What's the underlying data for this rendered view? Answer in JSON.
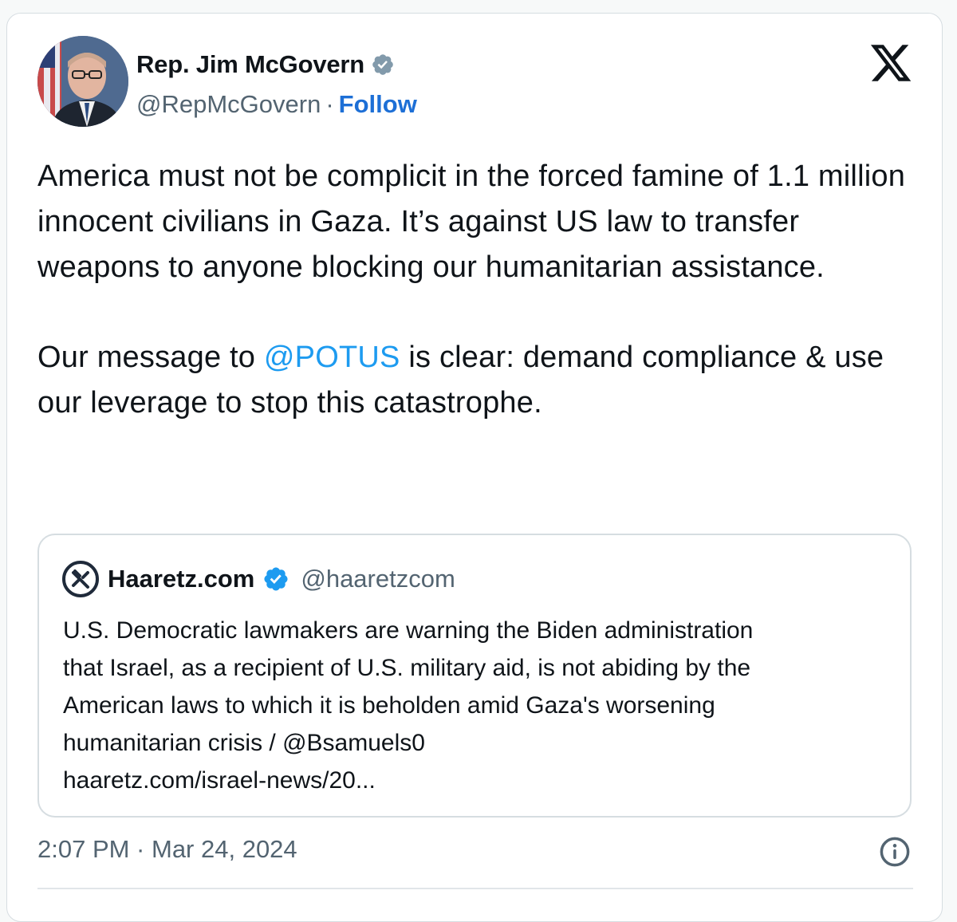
{
  "author": {
    "name": "Rep. Jim McGovern",
    "handle": "@RepMcGovern",
    "separator": "·",
    "follow_label": "Follow"
  },
  "platform_icon": "x-logo-icon",
  "tweet": {
    "paragraph1": "America must not be complicit in the forced famine of 1.1 million innocent civilians in Gaza. It’s against US law to transfer weapons to anyone blocking our humanitarian assistance.",
    "paragraph2_before": "Our message to ",
    "mention": "@POTUS",
    "paragraph2_after": " is clear: demand compliance & use our leverage to stop this catastrophe."
  },
  "quoted": {
    "name": "Haaretz.com",
    "handle": "@haaretzcom",
    "lines": [
      "U.S. Democratic lawmakers are warning the Biden administration",
      "that Israel, as a recipient of U.S. military aid, is not abiding by the",
      "American laws to which it is beholden amid Gaza's worsening",
      "humanitarian crisis / @Bsamuels0",
      "haaretz.com/israel-news/20..."
    ]
  },
  "timestamp": "2:07 PM · Mar 24, 2024",
  "colors": {
    "link": "#1d9bf0",
    "follow": "#1d6fd6",
    "verified_grey": "#829aab",
    "verified_blue": "#1d9bf0"
  }
}
